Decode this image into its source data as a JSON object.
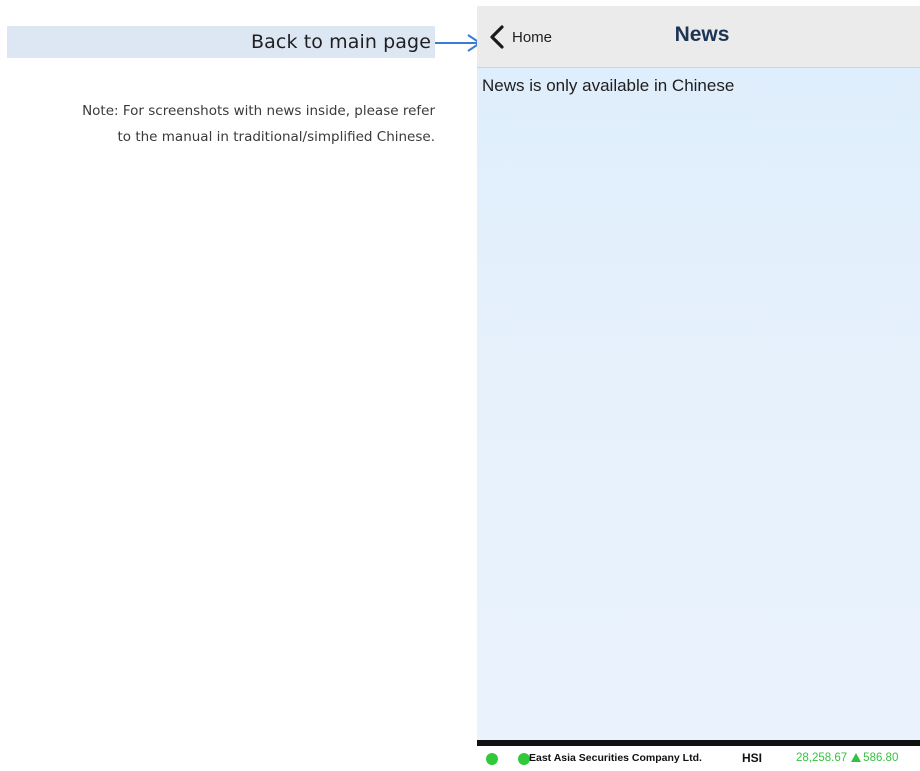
{
  "annotation": {
    "callout_label": "Back to main page",
    "note_line_1": "Note: For screenshots with news inside, please refer",
    "note_line_2": "to the manual in traditional/simplified Chinese."
  },
  "navbar": {
    "back_label": "Home",
    "title": "News"
  },
  "content": {
    "message": "News is only available in Chinese"
  },
  "ticker": {
    "company": "East Asia Securities Company Ltd.",
    "index_name": "HSI",
    "index_value": "28,258.67",
    "index_change": "586.80",
    "trend_icon": "triangle-up-icon"
  },
  "colors": {
    "callout_background": "#dde7f3",
    "arrow": "#3a7bd5",
    "navbar_background": "#ebebeb",
    "title_text": "#1c3555",
    "content_background": "#e3effc",
    "status_dot": "#2fc93a",
    "index_up": "#35c23f"
  }
}
